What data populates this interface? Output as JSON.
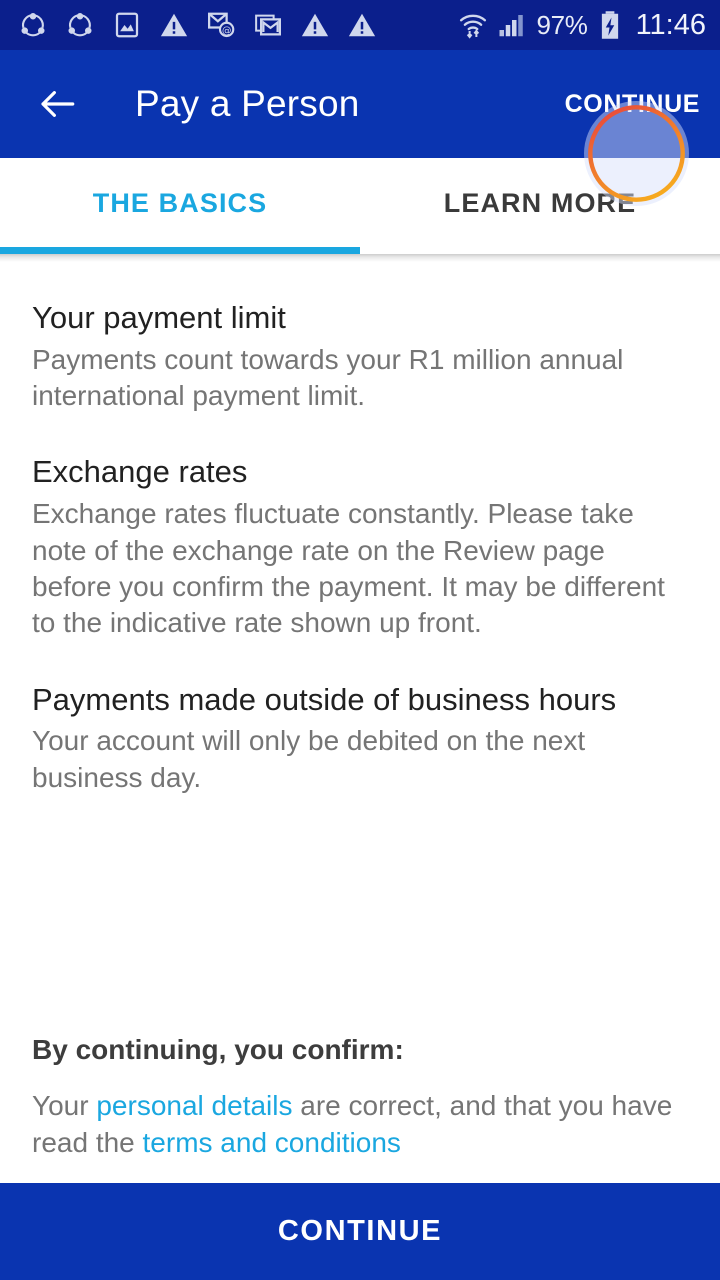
{
  "status_bar": {
    "background": "#0b1f8c",
    "left_icons": [
      {
        "name": "sync-share-icon"
      },
      {
        "name": "sync-share-icon"
      },
      {
        "name": "photo-icon"
      },
      {
        "name": "warning-triangle-icon"
      },
      {
        "name": "email-at-icon"
      },
      {
        "name": "gmail-icon"
      },
      {
        "name": "warning-triangle-icon"
      },
      {
        "name": "warning-triangle-icon"
      }
    ],
    "right_icons": [
      {
        "name": "wifi-transfer-icon"
      },
      {
        "name": "cellular-signal-icon"
      }
    ],
    "battery_percent": "97%",
    "battery_icon": "battery-charging-icon",
    "clock": "11:46"
  },
  "app_bar": {
    "background": "#0a34b0",
    "back_icon": "back-arrow-icon",
    "title": "Pay a Person",
    "action_label": "CONTINUE",
    "highlight": {
      "shape": "circle",
      "ring_color_top": "#e8453c",
      "ring_color_bottom": "#f5a623",
      "fill_color": "rgba(215,224,250,0.47)"
    }
  },
  "tabs": {
    "active_index": 0,
    "active_color": "#1aa7e0",
    "inactive_color": "#3a3a3a",
    "items": [
      {
        "label": "THE BASICS"
      },
      {
        "label": "LEARN MORE"
      }
    ]
  },
  "content": {
    "sections": [
      {
        "title": "Your payment limit",
        "body": "Payments count towards your R1 million annual international payment limit."
      },
      {
        "title": "Exchange rates",
        "body": "Exchange rates fluctuate constantly. Please take note of the exchange rate on the Review page before you confirm the payment. It may be different to the indicative rate shown up front."
      },
      {
        "title": "Payments made outside of business hours",
        "body": "Your account will only be debited on the next business day."
      }
    ],
    "confirm": {
      "heading": "By continuing, you confirm:",
      "text_part_1": "Your ",
      "link_1": "personal details",
      "text_part_2": " are correct, and that you have read the ",
      "link_2": "terms and conditions",
      "link_color": "#1aa7e0"
    }
  },
  "bottom_bar": {
    "label": "CONTINUE",
    "background": "#0a34b0"
  }
}
